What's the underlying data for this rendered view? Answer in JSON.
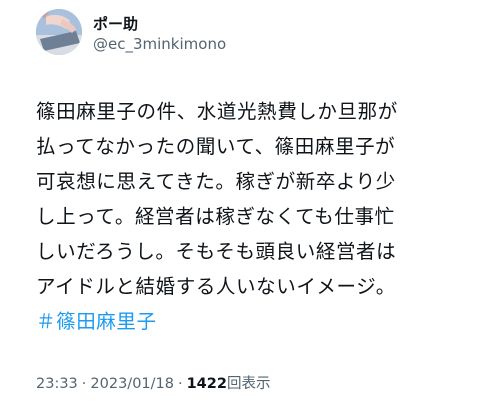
{
  "author": {
    "display_name": "ポー助",
    "handle": "@ec_3minkimono",
    "avatar_icon": "user-avatar-icon"
  },
  "tweet": {
    "lines": [
      "篠田麻里子の件、水道光熱費しか旦那が",
      "払ってなかったの聞いて、篠田麻里子が",
      "可哀想に思えてきた。稼ぎが新卒より少",
      "し上って。経営者は稼ぎなくても仕事忙",
      "しいだろうし。そもそも頭良い経営者は",
      "アイドルと結婚する人いないイメージ。"
    ],
    "hashtag": "＃篠田麻里子"
  },
  "meta": {
    "time": "23:33",
    "separator": "·",
    "date": "2023/01/18",
    "views_count": "1422",
    "views_label": "回表示"
  },
  "colors": {
    "text": "#0f1419",
    "secondary": "#536471",
    "link": "#1d9bf0"
  }
}
